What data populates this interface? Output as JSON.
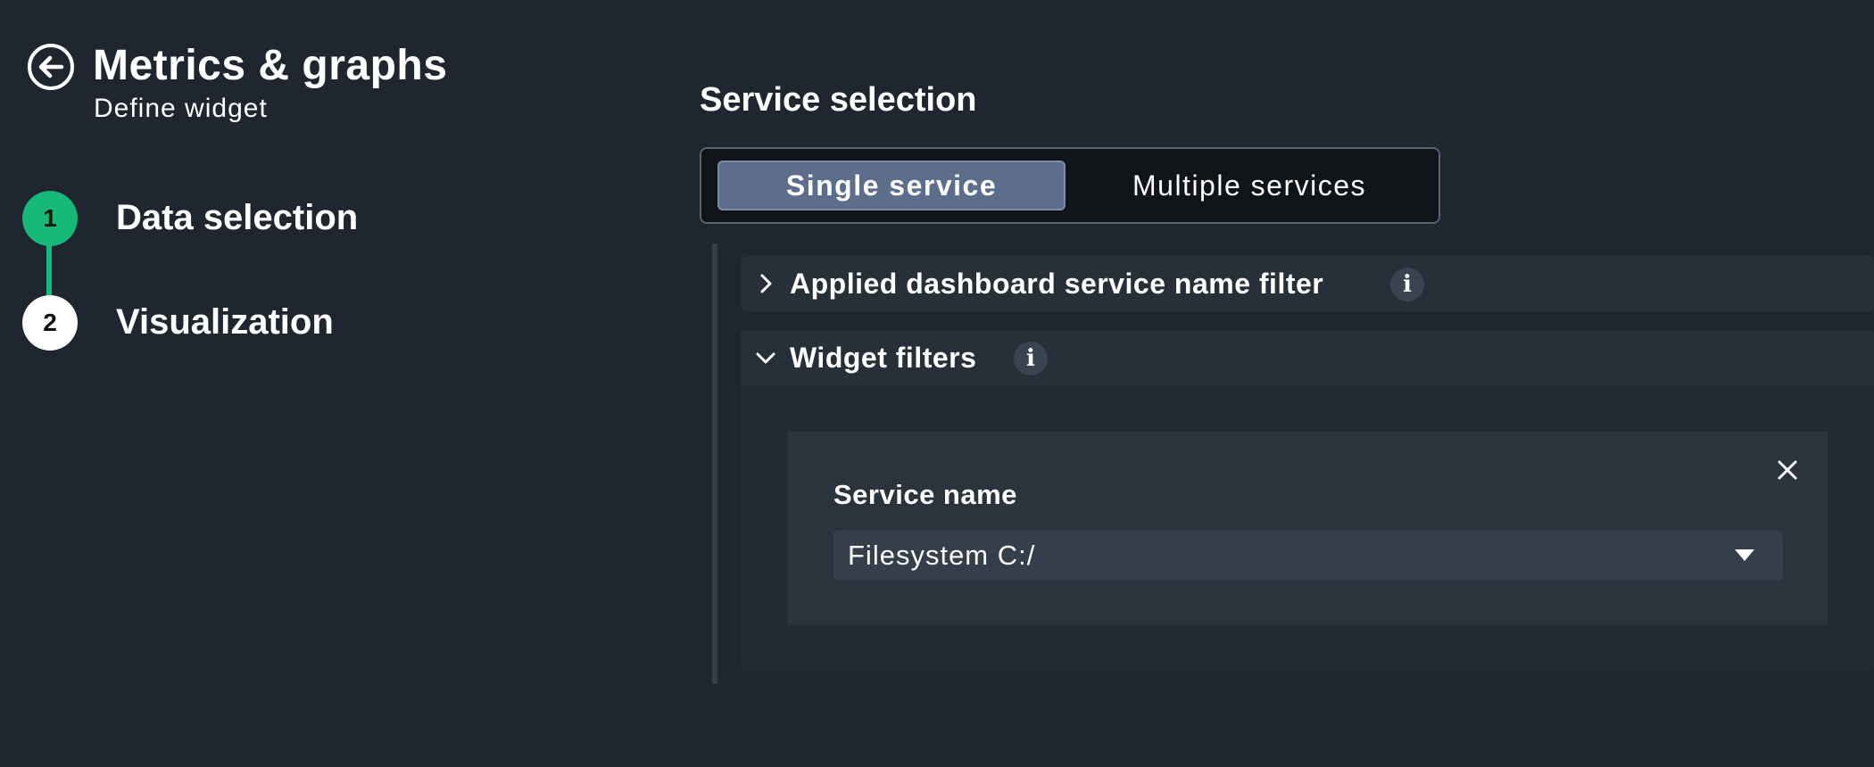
{
  "header": {
    "title": "Metrics & graphs",
    "subtitle": "Define widget",
    "back_icon": "arrow-left-circle-icon"
  },
  "stepper": {
    "accent_color": "#17b978",
    "steps": [
      {
        "number": "1",
        "label": "Data selection",
        "state": "active"
      },
      {
        "number": "2",
        "label": "Visualization",
        "state": "upcoming"
      }
    ]
  },
  "main": {
    "section_title": "Service selection",
    "toggle": {
      "options": [
        "Single service",
        "Multiple services"
      ],
      "selected": "Single service"
    },
    "accordions": [
      {
        "title": "Applied dashboard service name filter",
        "expanded": false,
        "info_icon": "info-icon"
      },
      {
        "title": "Widget filters",
        "expanded": true,
        "info_icon": "info-icon"
      }
    ],
    "filter_card": {
      "field_label": "Service name",
      "select_value": "Filesystem C:/",
      "close_icon": "close-icon",
      "caret_icon": "caret-down-icon"
    }
  },
  "colors": {
    "background": "#1f2630",
    "accordion_header": "#272f39",
    "toggle_selected": "#5c6e8c"
  }
}
